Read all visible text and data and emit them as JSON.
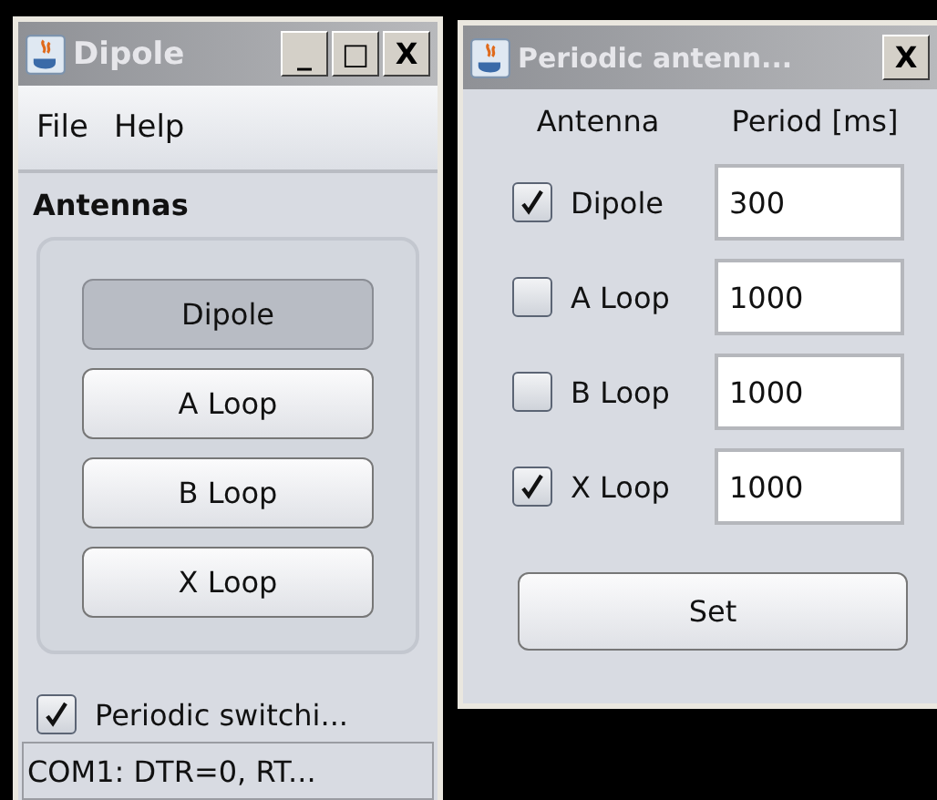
{
  "windows": [
    {
      "title": "Dipole",
      "controls": [
        "_",
        "□",
        "X"
      ],
      "menu": [
        "File",
        "Help"
      ],
      "group_label": "Antennas",
      "buttons": [
        {
          "label": "Dipole",
          "selected": true
        },
        {
          "label": "A Loop",
          "selected": false
        },
        {
          "label": "B Loop",
          "selected": false
        },
        {
          "label": "X Loop",
          "selected": false
        }
      ],
      "checkbox": {
        "label": "Periodic switchi...",
        "checked": true
      },
      "status_bar": "COM1: DTR=0, RT..."
    },
    {
      "title": "Periodic antenn...",
      "controls": [
        "X"
      ],
      "columns": [
        "Antenna",
        "Period [ms]"
      ],
      "rows": [
        {
          "label": "Dipole",
          "checked": true,
          "value": "300"
        },
        {
          "label": "A Loop",
          "checked": false,
          "value": "1000"
        },
        {
          "label": "B Loop",
          "checked": false,
          "value": "1000"
        },
        {
          "label": "X Loop",
          "checked": true,
          "value": "1000"
        }
      ],
      "buttons": [
        {
          "label": "Set",
          "selected": false
        }
      ]
    }
  ]
}
